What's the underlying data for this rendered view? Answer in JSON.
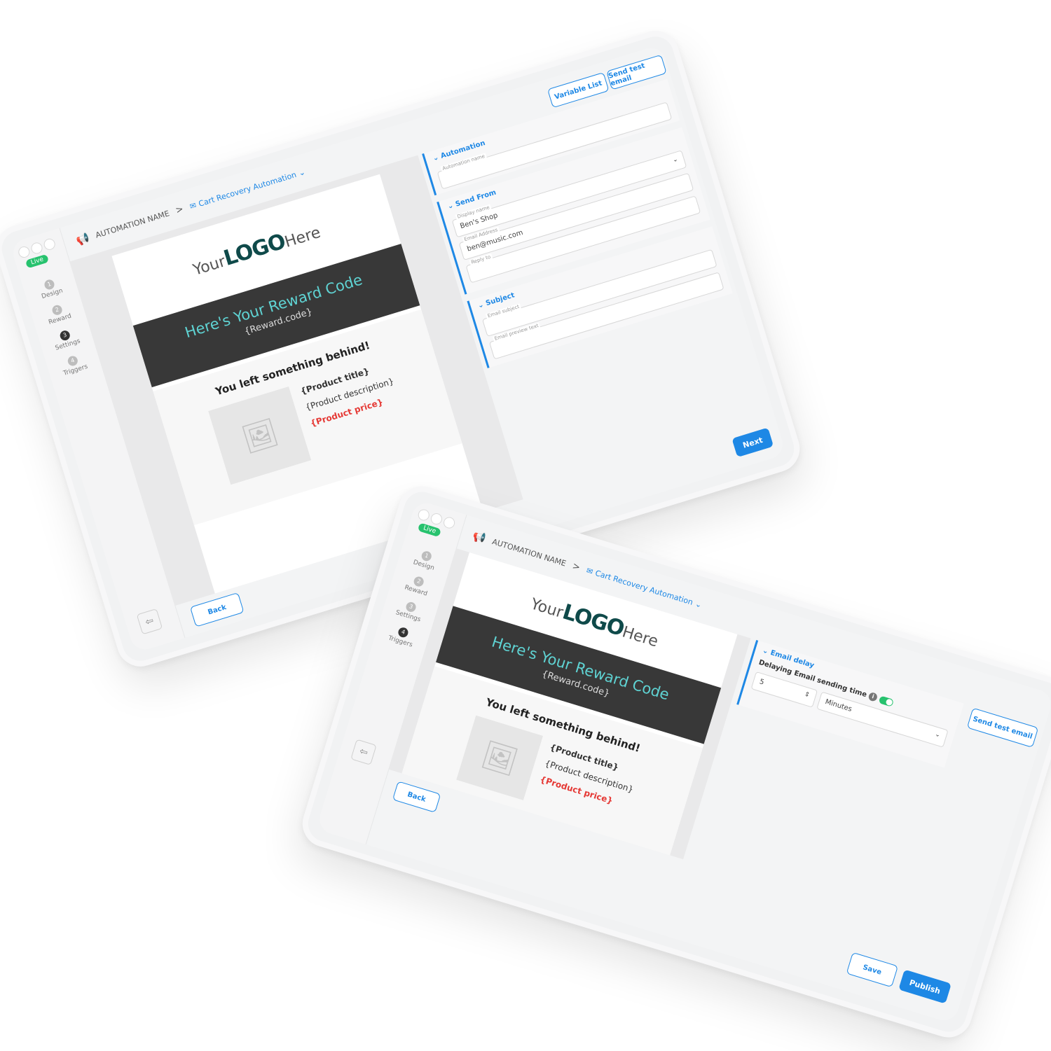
{
  "common": {
    "live_badge": "Live",
    "automation_name": "AUTOMATION NAME",
    "breadcrumb_sep": ">",
    "automation_type": "Cart Recovery Automation",
    "steps": [
      {
        "num": "1",
        "label": "Design"
      },
      {
        "num": "2",
        "label": "Reward"
      },
      {
        "num": "3",
        "label": "Settings"
      },
      {
        "num": "4",
        "label": "Triggers"
      }
    ],
    "email": {
      "logo_pre": "Your",
      "logo_main": "LOGO",
      "logo_post": "Here",
      "banner_title": "Here's Your Reward Code",
      "banner_code": "{Reward.code}",
      "left_title": "You left something behind!",
      "product_title": "{Product title}",
      "product_description": "{Product description}",
      "product_price": "{Product price}"
    },
    "back_button": "Back"
  },
  "screen1": {
    "active_step": 3,
    "variable_list_button": "Variable List",
    "send_test_button": "Send test email",
    "automation_section": {
      "title": "Automation",
      "name_label": "Automation name",
      "name_value": ""
    },
    "send_from_section": {
      "title": "Send From",
      "display_name_label": "Display name",
      "display_name_value": "Ben's Shop",
      "email_label": "Email Address",
      "email_value": "ben@music.com",
      "reply_label": "Reply to",
      "reply_value": ""
    },
    "subject_section": {
      "title": "Subject",
      "subject_label": "Email subject",
      "preview_label": "Email preview text"
    },
    "next_button": "Next"
  },
  "screen2": {
    "active_step": 4,
    "send_test_button": "Send test email",
    "delay_section": {
      "title": "Email delay",
      "label": "Delaying Email sending time",
      "amount": "5",
      "unit": "Minutes",
      "toggle_on": true
    },
    "save_button": "Save",
    "publish_button": "Publish"
  },
  "colors": {
    "accent": "#1e88e5",
    "live": "#27c26e",
    "banner_bg": "#383838",
    "banner_text": "#5fd3d3",
    "price": "#e53935"
  }
}
